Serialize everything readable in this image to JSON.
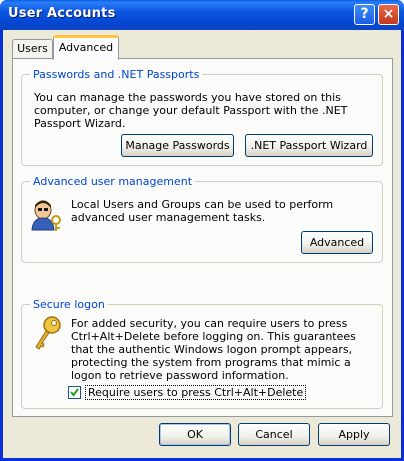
{
  "window": {
    "title": "User Accounts"
  },
  "titlebar_buttons": {
    "help": "?",
    "close": "×"
  },
  "tabs": [
    {
      "label": "Users"
    },
    {
      "label": "Advanced"
    }
  ],
  "passwords": {
    "title": "Passwords and .NET Passports",
    "text": "You can manage the passwords you have stored on this computer, or change your default Passport with the .NET Passport Wizard.",
    "manage_button": "Manage Passwords",
    "wizard_button": ".NET Passport Wizard"
  },
  "advanced_mgmt": {
    "title": "Advanced user management",
    "text": "Local Users and Groups can be used to perform advanced user management tasks.",
    "advanced_button": "Advanced"
  },
  "secure_logon": {
    "title": "Secure logon",
    "text": "For added security, you can require users to press Ctrl+Alt+Delete before logging on. This guarantees that the authentic Windows logon prompt appears, protecting the system from programs that mimic a logon to retrieve password information.",
    "checkbox_label": "Require users to press Ctrl+Alt+Delete",
    "checkbox_checked": true
  },
  "footer": {
    "ok": "OK",
    "cancel": "Cancel",
    "apply": "Apply"
  }
}
